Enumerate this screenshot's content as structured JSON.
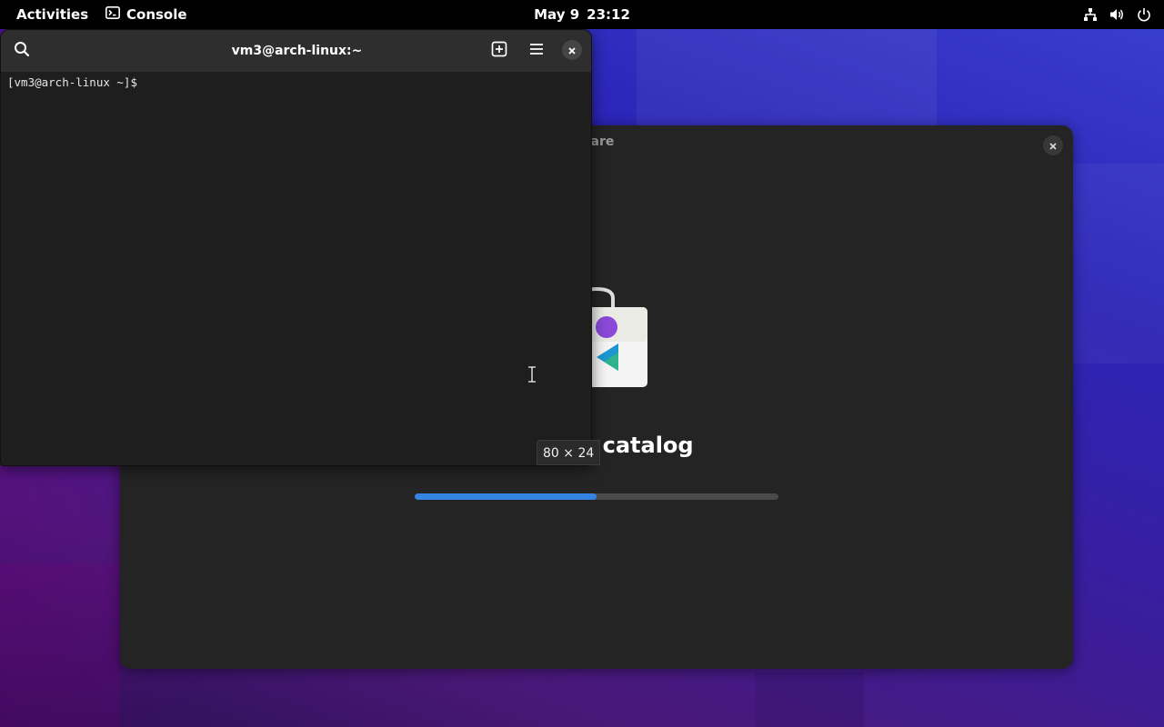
{
  "topbar": {
    "activities": "Activities",
    "app_menu": {
      "label": "Console",
      "icon": "terminal-icon"
    },
    "clock": {
      "date": "May 9",
      "time": "23:12"
    },
    "status_icons": [
      "network-wired-icon",
      "volume-icon",
      "power-icon"
    ]
  },
  "console_window": {
    "title": "vm3@arch-linux:~",
    "header_icons": [
      "search-icon",
      "new-tab-icon",
      "hamburger-menu-icon",
      "close-icon"
    ],
    "prompt": "[vm3@arch-linux ~]$",
    "size_tooltip": "80 × 24"
  },
  "software_window": {
    "title": "ware",
    "heading": "oftware catalog",
    "progress_fraction": 0.5,
    "icon": "software-bag-icon"
  },
  "colors": {
    "accent": "#3584e4",
    "topbar_bg": "#000000",
    "window_bg": "#242424",
    "terminal_bg": "#1e1e1e"
  }
}
